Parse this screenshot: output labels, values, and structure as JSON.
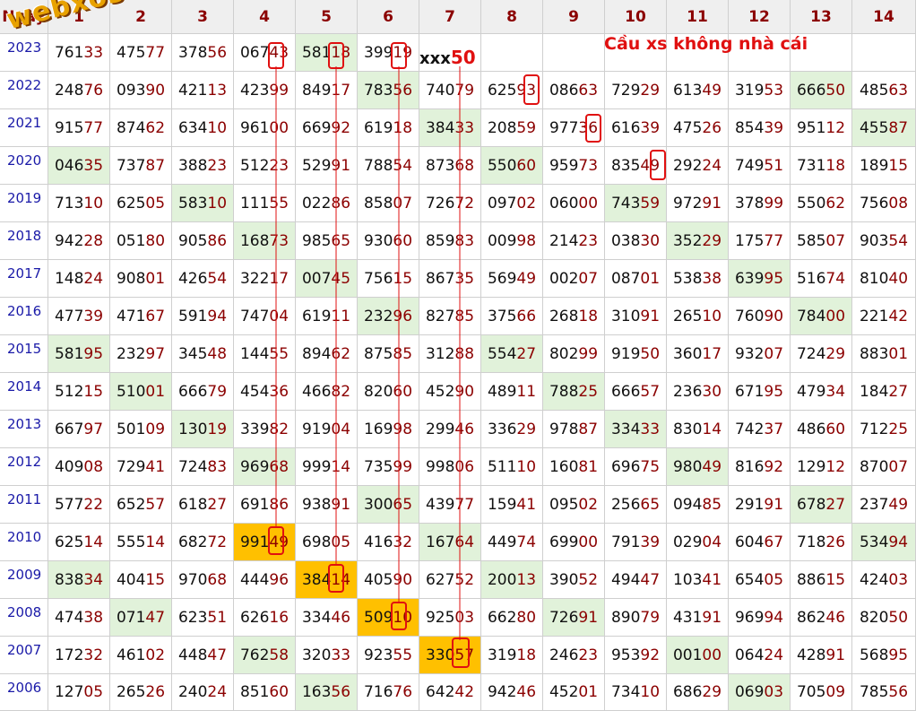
{
  "header": {
    "corner": "Ngày",
    "columns": [
      "1",
      "2",
      "3",
      "4",
      "5",
      "6",
      "7",
      "8",
      "9",
      "10",
      "11",
      "12",
      "13",
      "14"
    ]
  },
  "rows": [
    {
      "year": "2023",
      "cells": [
        "76133",
        "47577",
        "37856",
        "06743",
        "58118",
        "39919",
        "",
        "",
        "",
        "",
        "",
        "",
        "",
        ""
      ]
    },
    {
      "year": "2022",
      "cells": [
        "24876",
        "09390",
        "42113",
        "42399",
        "84917",
        "78356",
        "74079",
        "62593",
        "08663",
        "72929",
        "61349",
        "31953",
        "66650",
        "48563"
      ]
    },
    {
      "year": "2021",
      "cells": [
        "91577",
        "87462",
        "63410",
        "96100",
        "66992",
        "61918",
        "38433",
        "20859",
        "97736",
        "61639",
        "47526",
        "85439",
        "95112",
        "45587"
      ]
    },
    {
      "year": "2020",
      "cells": [
        "04635",
        "73787",
        "38823",
        "51223",
        "52991",
        "78854",
        "87368",
        "55060",
        "95973",
        "83549",
        "29224",
        "74951",
        "73118",
        "18915"
      ]
    },
    {
      "year": "2019",
      "cells": [
        "71310",
        "62505",
        "58310",
        "11155",
        "02286",
        "85807",
        "72672",
        "09702",
        "06000",
        "74359",
        "97291",
        "37899",
        "55062",
        "75608"
      ]
    },
    {
      "year": "2018",
      "cells": [
        "94228",
        "05180",
        "90586",
        "16873",
        "98565",
        "93060",
        "85983",
        "00998",
        "21423",
        "03830",
        "35229",
        "17577",
        "58507",
        "90354"
      ]
    },
    {
      "year": "2017",
      "cells": [
        "14824",
        "90801",
        "42654",
        "32217",
        "00745",
        "75615",
        "86735",
        "56949",
        "00207",
        "08701",
        "53838",
        "63995",
        "51674",
        "81040"
      ]
    },
    {
      "year": "2016",
      "cells": [
        "47739",
        "47167",
        "59194",
        "74704",
        "61911",
        "23296",
        "82785",
        "37566",
        "26818",
        "31091",
        "26510",
        "76090",
        "78400",
        "22142"
      ]
    },
    {
      "year": "2015",
      "cells": [
        "58195",
        "23297",
        "34548",
        "14455",
        "89462",
        "87585",
        "31288",
        "55427",
        "80299",
        "91950",
        "36017",
        "93207",
        "72429",
        "88301"
      ]
    },
    {
      "year": "2014",
      "cells": [
        "51215",
        "51001",
        "66679",
        "45436",
        "46682",
        "82060",
        "45290",
        "48911",
        "78825",
        "66657",
        "23630",
        "67195",
        "47934",
        "18427"
      ]
    },
    {
      "year": "2013",
      "cells": [
        "66797",
        "50109",
        "13019",
        "33982",
        "91904",
        "16998",
        "29946",
        "33629",
        "97887",
        "33433",
        "83014",
        "74237",
        "48660",
        "71225"
      ]
    },
    {
      "year": "2012",
      "cells": [
        "40908",
        "72941",
        "72483",
        "96968",
        "99914",
        "73599",
        "99806",
        "51110",
        "16081",
        "69675",
        "98049",
        "81692",
        "12912",
        "87007"
      ]
    },
    {
      "year": "2011",
      "cells": [
        "57722",
        "65257",
        "61827",
        "69186",
        "93891",
        "30065",
        "43977",
        "15941",
        "09502",
        "25665",
        "09485",
        "29191",
        "67827",
        "23749"
      ]
    },
    {
      "year": "2010",
      "cells": [
        "62514",
        "55514",
        "68272",
        "99149",
        "69805",
        "41632",
        "16764",
        "44974",
        "69900",
        "79139",
        "02904",
        "60467",
        "71826",
        "53494"
      ]
    },
    {
      "year": "2009",
      "cells": [
        "83834",
        "40415",
        "97068",
        "44496",
        "38414",
        "40590",
        "62752",
        "20013",
        "39052",
        "49447",
        "10341",
        "65405",
        "88615",
        "42403"
      ]
    },
    {
      "year": "2008",
      "cells": [
        "47438",
        "07147",
        "62351",
        "62616",
        "33446",
        "50910",
        "92503",
        "66280",
        "72691",
        "89079",
        "43191",
        "96994",
        "86246",
        "82050"
      ]
    },
    {
      "year": "2007",
      "cells": [
        "17232",
        "46102",
        "44847",
        "76258",
        "32033",
        "92355",
        "33057",
        "31918",
        "24623",
        "95392",
        "00100",
        "06424",
        "42891",
        "56895"
      ]
    },
    {
      "year": "2006",
      "cells": [
        "12705",
        "26526",
        "24024",
        "85160",
        "16356",
        "71676",
        "64242",
        "94246",
        "45201",
        "73410",
        "68629",
        "06903",
        "70509",
        "78556"
      ]
    }
  ],
  "green_cells": [
    [
      0,
      4
    ],
    [
      1,
      5
    ],
    [
      1,
      12
    ],
    [
      2,
      6
    ],
    [
      2,
      13
    ],
    [
      3,
      0
    ],
    [
      3,
      7
    ],
    [
      4,
      2
    ],
    [
      4,
      9
    ],
    [
      5,
      3
    ],
    [
      5,
      10
    ],
    [
      6,
      4
    ],
    [
      6,
      11
    ],
    [
      7,
      5
    ],
    [
      7,
      12
    ],
    [
      8,
      0
    ],
    [
      8,
      7
    ],
    [
      9,
      1
    ],
    [
      9,
      8
    ],
    [
      10,
      2
    ],
    [
      10,
      9
    ],
    [
      11,
      3
    ],
    [
      11,
      10
    ],
    [
      12,
      5
    ],
    [
      12,
      12
    ],
    [
      13,
      6
    ],
    [
      13,
      13
    ],
    [
      14,
      0
    ],
    [
      14,
      7
    ],
    [
      15,
      1
    ],
    [
      15,
      8
    ],
    [
      16,
      3
    ],
    [
      16,
      10
    ],
    [
      17,
      4
    ],
    [
      17,
      11
    ]
  ],
  "orange_cells": [
    [
      13,
      3
    ],
    [
      14,
      4
    ],
    [
      15,
      5
    ],
    [
      16,
      6
    ]
  ],
  "watermark": "webxoso.net",
  "caption": "Cầu xs không nhà cái",
  "prediction": {
    "prefix": "xxx",
    "digits": "50"
  },
  "colors": {
    "header_text": "#8b0000",
    "year_text": "#1a1aa8",
    "green": "#e1f2da",
    "orange": "#ffc000",
    "marker": "#e01010"
  }
}
